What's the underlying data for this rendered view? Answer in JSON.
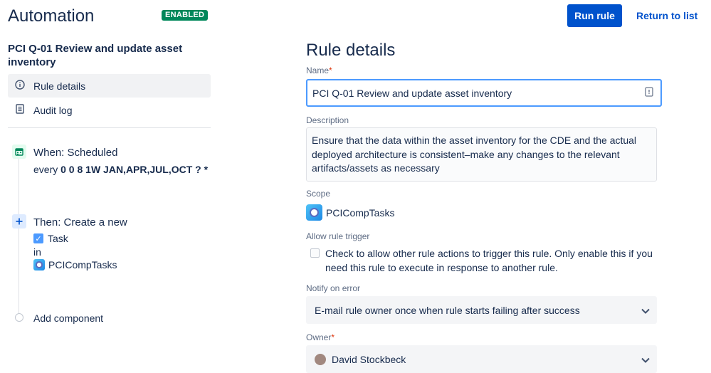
{
  "header": {
    "title": "Automation",
    "status_badge": "ENABLED",
    "run_rule_label": "Run rule",
    "return_label": "Return to list"
  },
  "sidebar": {
    "rule_name": "PCI Q-01 Review and update asset inventory",
    "nav": [
      {
        "label": "Rule details",
        "icon": "info-icon",
        "active": true
      },
      {
        "label": "Audit log",
        "icon": "document-icon",
        "active": false
      }
    ],
    "trigger": {
      "title": "When: Scheduled",
      "prefix": "every ",
      "cron": "0 0 8 1W JAN,APR,JUL,OCT ? *",
      "icon": "calendar-icon"
    },
    "action": {
      "title": "Then: Create a new",
      "issue_type": "Task",
      "in_label": "in",
      "project": "PCICompTasks",
      "icon": "plus-icon"
    },
    "add_component_label": "Add component"
  },
  "main": {
    "heading": "Rule details",
    "name_label": "Name",
    "required_mark": "*",
    "name_value": "PCI Q-01 Review and update asset inventory",
    "description_label": "Description",
    "description_value": "Ensure that the data within the asset inventory for the CDE and the actual deployed architecture is consistent–make any changes to the relevant artifacts/assets as necessary",
    "scope_label": "Scope",
    "scope_value": "PCICompTasks",
    "allow_trigger_label": "Allow rule trigger",
    "allow_trigger_text": "Check to allow other rule actions to trigger this rule. Only enable this if you need this rule to execute in response to another rule.",
    "allow_trigger_checked": false,
    "notify_label": "Notify on error",
    "notify_value": "E-mail rule owner once when rule starts failing after success",
    "owner_label": "Owner",
    "owner_value": "David Stockbeck"
  },
  "colors": {
    "primary": "#0052cc",
    "badge": "#00875a",
    "text": "#172b4d",
    "muted": "#5e6c84"
  }
}
